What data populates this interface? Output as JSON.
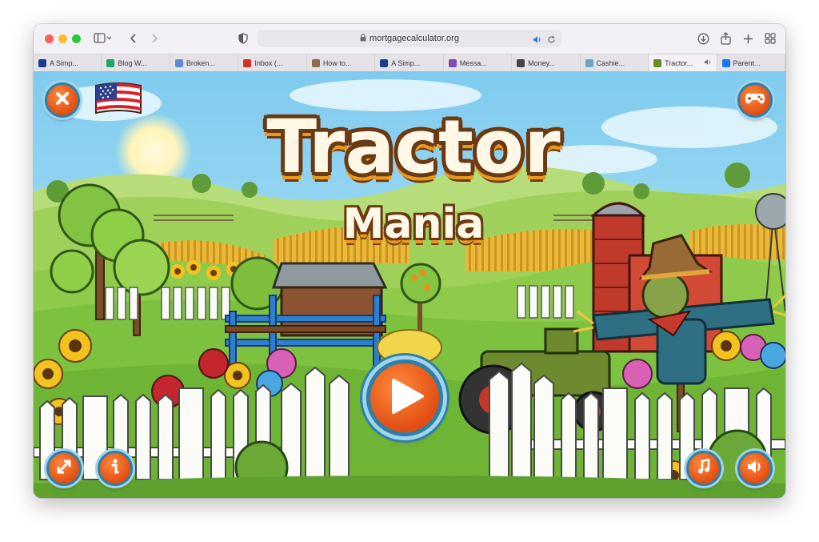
{
  "browser": {
    "url": "mortgagecalculator.org",
    "tabs": [
      {
        "label": "A Simp...",
        "icon": "paypal-icon",
        "color": "#1a3e8c"
      },
      {
        "label": "Blog W...",
        "icon": "sheets-icon",
        "color": "#1fa463"
      },
      {
        "label": "Broken...",
        "icon": "broken-link-icon",
        "color": "#5b8dd6"
      },
      {
        "label": "Inbox (...",
        "icon": "gmail-icon",
        "color": "#d93025"
      },
      {
        "label": "How to...",
        "icon": "howto-icon",
        "color": "#8a6d4a"
      },
      {
        "label": "A Simp...",
        "icon": "paypal-icon",
        "color": "#1a3e8c"
      },
      {
        "label": "Messa...",
        "icon": "message-icon",
        "color": "#7a4fb0"
      },
      {
        "label": "Money...",
        "icon": "calculator-icon",
        "color": "#444444"
      },
      {
        "label": "Cashie...",
        "icon": "cashier-icon",
        "color": "#6aa6c8"
      },
      {
        "label": "Tractor...",
        "icon": "tractor-icon",
        "color": "#6b8e23",
        "active": true
      },
      {
        "label": "Parent...",
        "icon": "facebook-icon",
        "color": "#1877f2"
      }
    ]
  },
  "game": {
    "title": "Tractor",
    "subtitle": "Mania",
    "buttons": {
      "close": "close-icon",
      "language": "us-flag-icon",
      "more_games": "gamepad-icon",
      "play": "play-icon",
      "fullscreen": "fullscreen-icon",
      "info": "info-icon",
      "music": "music-icon",
      "sound": "speaker-icon"
    },
    "colors": {
      "button_orange": "#e8561a",
      "button_ring": "#2f7fa6",
      "title_fill": "#fff8e6",
      "title_outline": "#6b3a12",
      "sky": "#8fd3f1",
      "grass": "#7cc23f"
    }
  }
}
